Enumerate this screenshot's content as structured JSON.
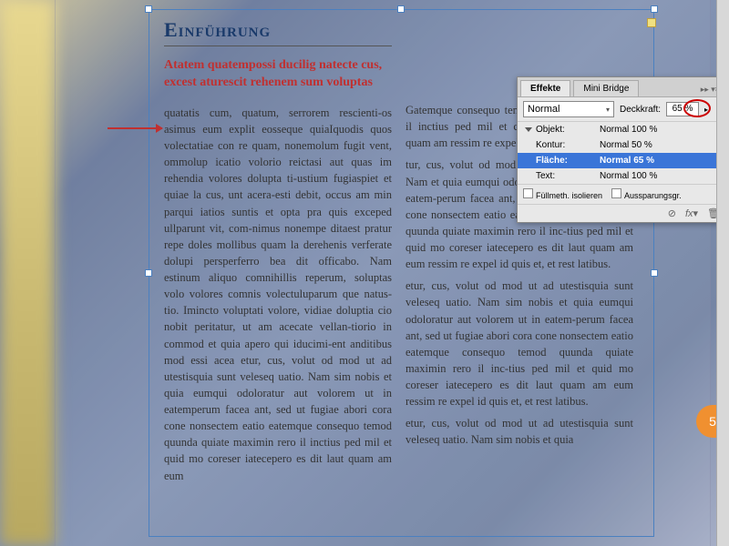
{
  "doc": {
    "heading": "Einführung",
    "subhead": "Atatem quatempossi ducilig natecte cus, excest aturescit rehenem sum voluptas",
    "col1": "quatatis cum, quatum, serrorem rescienti-os asimus eum explit eosseque quiaIquodis quos volectatiae con re quam, nonemolum fugit vent, ommolup icatio volorio reictasi aut quas im rehendia volores dolupta ti-ustium fugiaspiet et quiae la cus, unt acera-esti debit, occus am min parqui iatios suntis et opta pra quis exceped ullparunt vit, com-nimus nonempe ditaest pratur repe doles mollibus quam la derehenis verferate dolupi persperferro bea dit officabo. Nam estinum aliquo comnihillis reperum, soluptas volo volores comnis volectuluparum que natus-tio. Imincto voluptati volore, vidiae doluptia cio nobit peritatur, ut am acecate vellan-tiorio in commod et quia apero qui iducimi-ent anditibus mod essi acea etur, cus, volut od mod ut ad utestisquia sunt veleseq uatio. Nam sim nobis et quia eumqui odoloratur aut volorem ut in eatemperum facea ant, sed ut fugiae abori cora cone nonsectem eatio eatemque consequo temod quunda quiate maximin rero il inctius ped mil et quid mo coreser iatecepero es dit laut quam am eum",
    "col2a": "Gatemque consequo temod quiate maximin rero il inctius ped mil et coreser iatecepero es dit quam am ressim re expel id quis et,",
    "col2b": "tur, cus, volut od mod sim sunt veleseq uatio. Nam et quia eumqui odoloratur aut volorem ut in eatem-perum facea ant, sed ut fugiae abori cora cone nonsectem eatio eatemque consequo temod quunda quiate maximin rero il inc-tius ped mil et quid mo coreser iatecepero es dit laut quam am eum ressim re expel id quis et, et rest latibus.",
    "col2c": "etur, cus, volut od mod ut ad utestisquia sunt veleseq uatio. Nam sim nobis et quia eumqui odoloratur aut volorem ut in eatem-perum facea ant, sed ut fugiae abori cora cone nonsectem eatio eatemque consequo temod quunda quiate maximin rero il inc-tius ped mil et quid mo coreser iatecepero es dit laut quam am eum ressim re expel id quis et, et rest latibus.",
    "col2d": "etur, cus, volut od mod ut ad utestisquia sunt veleseq uatio. Nam sim nobis et quia"
  },
  "panel": {
    "tabs": [
      "Effekte",
      "Mini Bridge"
    ],
    "blend_mode": "Normal",
    "opacity_label": "Deckkraft:",
    "opacity_value": "65 %",
    "rows": [
      {
        "label": "Objekt:",
        "value": "Normal 100 %"
      },
      {
        "label": "Kontur:",
        "value": "Normal 50 %"
      },
      {
        "label": "Fläche:",
        "value": "Normal 65 %"
      },
      {
        "label": "Text:",
        "value": "Normal 100 %"
      }
    ],
    "foot1": "Füllmeth. isolieren",
    "foot2": "Aussparungsgr."
  },
  "page_num": "5"
}
